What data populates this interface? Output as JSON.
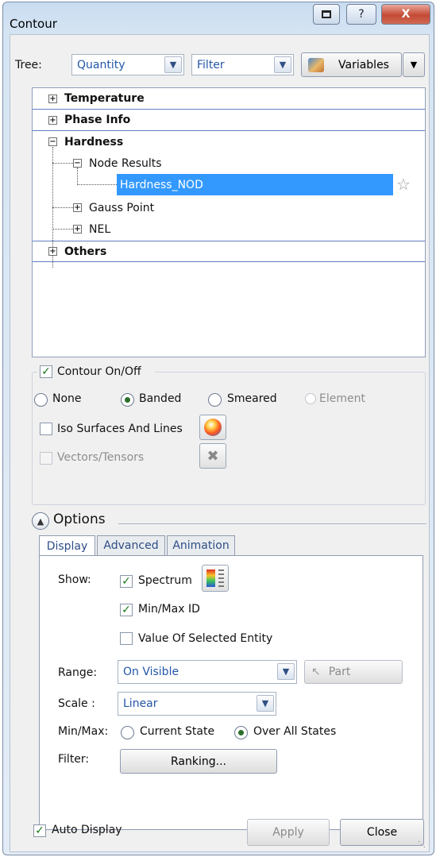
{
  "window": {
    "title": "Contour",
    "help_glyph": "?",
    "close_glyph": "X"
  },
  "tree_bar": {
    "tree_label": "Tree:",
    "tree_value": "Quantity",
    "filter_value": "Filter",
    "variables_label": "Variables"
  },
  "tree": {
    "categories": [
      "Temperature",
      "Phase Info",
      "Hardness",
      "Others"
    ],
    "node_results": "Node Results",
    "selected_item": "Hardness_NOD",
    "gauss_point": "Gauss Point",
    "nel": "NEL"
  },
  "contour": {
    "group_label": "Contour On/Off",
    "options": [
      "None",
      "Banded",
      "Smeared",
      "Element"
    ],
    "selected_option": "Banded",
    "iso_label": "Iso Surfaces And Lines",
    "vectors_label": "Vectors/Tensors"
  },
  "options": {
    "label": "Options",
    "tabs": [
      "Display",
      "Advanced",
      "Animation"
    ],
    "active_tab": "Display",
    "show_label": "Show:",
    "spectrum_label": "Spectrum",
    "minmax_id_label": "Min/Max ID",
    "value_selected_label": "Value Of Selected Entity",
    "range_label": "Range:",
    "range_value": "On Visible",
    "part_label": "Part",
    "scale_label": "Scale :",
    "scale_value": "Linear",
    "minmax_label": "Min/Max:",
    "current_state_label": "Current State",
    "over_all_states_label": "Over All States",
    "filter_label": "Filter:",
    "ranking_label": "Ranking..."
  },
  "footer": {
    "auto_display_label": "Auto Display",
    "apply_label": "Apply",
    "close_label": "Close"
  },
  "colors": {
    "selection": "#3399ff",
    "accent_text": "#2357a8",
    "window_frame": "#c9dcf0"
  }
}
